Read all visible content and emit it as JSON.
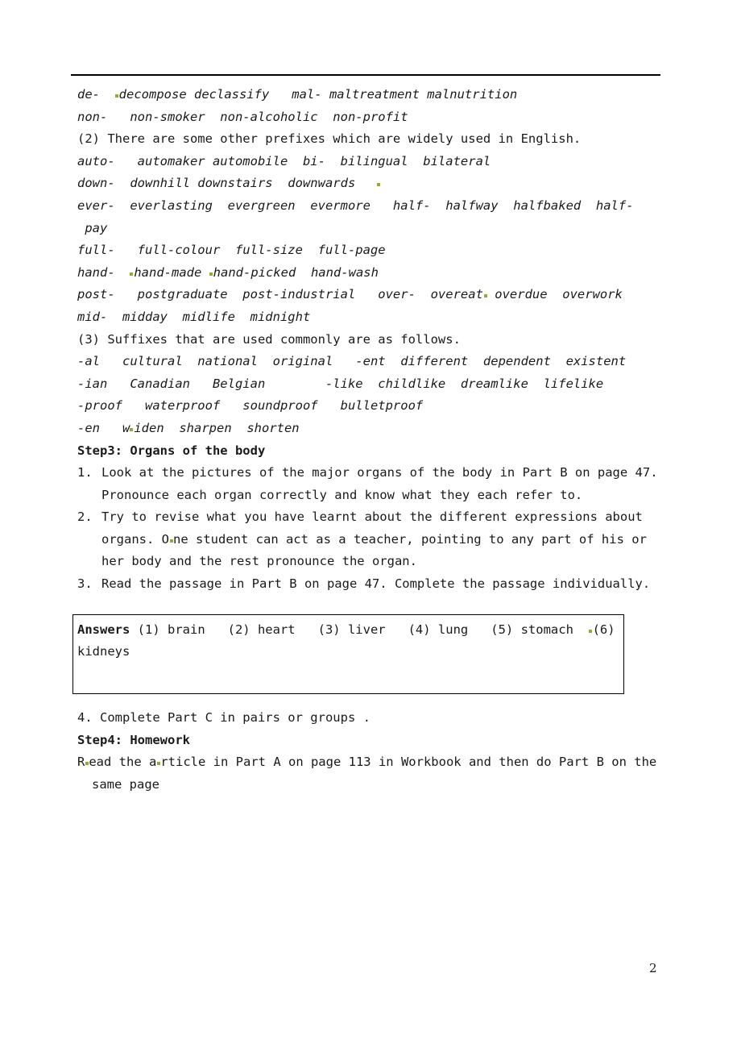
{
  "document": {
    "page_number": "2",
    "spellcheck_mark_color": "#9aa832"
  },
  "word_formation": {
    "prefix_lines": [
      {
        "id": "de_mal",
        "text": "de-   decompose declassify   mal- maltreatment malnutrition",
        "pre_mark_word": "decompose"
      },
      {
        "id": "non",
        "text": "non-   non-smoker  non-alcoholic  non-profit"
      }
    ],
    "intro_2": "(2) There are some other prefixes which are widely used in English.",
    "other_prefix_lines": [
      {
        "id": "auto_bi",
        "text": "auto-   automaker automobile  bi-  bilingual  bilateral"
      },
      {
        "id": "down",
        "text": "down-  downhill downstairs  downwards"
      },
      {
        "id": "ever_half",
        "text": "ever-  everlasting  evergreen  evermore   half-  halfway  halfbaked  half-"
      },
      {
        "id": "pay_cont",
        "text": " pay"
      },
      {
        "id": "full",
        "text": "full-   full-colour  full-size  full-page"
      },
      {
        "id": "hand",
        "text": "hand-   hand-made  hand-picked  hand-wash"
      },
      {
        "id": "post_over",
        "text": "post-   postgraduate  post-industrial   over-  overeat  overdue  overwork"
      },
      {
        "id": "mid",
        "text": "mid-  midday  midlife  midnight"
      }
    ],
    "intro_3": "(3) Suffixes that are used commonly are as follows.",
    "suffix_lines": [
      {
        "id": "al_ent",
        "text": "-al   cultural  national  original   -ent  different  dependent  existent"
      },
      {
        "id": "ian_like",
        "text": "-ian   Canadian   Belgian        -like  childlike  dreamlike  lifelike"
      },
      {
        "id": "proof",
        "text": "-proof   waterproof   soundproof   bulletproof"
      },
      {
        "id": "en",
        "text": "-en   widen  sharpen  shorten"
      }
    ]
  },
  "step3": {
    "heading": "Step3: Organs of the body",
    "items": [
      {
        "marker": "1.",
        "line1": "Look at the pictures of the major organs of the body in Part B on page 47.",
        "line2": "Pronounce each organ correctly and know what they each refer to."
      },
      {
        "marker": "2.",
        "line1": "Try to revise what you have learnt about the different expressions about",
        "line2": "organs. One student can act as a teacher, pointing to any part of his or",
        "line3": "her body and the rest pronounce the organ."
      },
      {
        "marker": "3.",
        "line1": "Read the passage in Part B on page 47. Complete the passage individually.",
        "line2": ""
      }
    ]
  },
  "answers_box": {
    "label": "Answers",
    "line1": " (1) brain   (2) heart   (3) liver   (4) lung   (5) stomach  ",
    "trailing": "(6)",
    "line2": "kidneys"
  },
  "step3_item4": "4. Complete Part C in pairs or groups .",
  "step4": {
    "heading": "Step4: Homework",
    "line1": "Read the article in Part A on page 113 in Workbook and then do Part B on the",
    "line2": "same page"
  }
}
